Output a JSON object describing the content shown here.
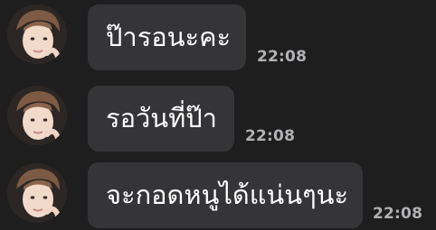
{
  "chat": {
    "messages": [
      {
        "text": "ป๊ารอนะคะ",
        "time": "22:08",
        "avatar": "user-avatar-icon"
      },
      {
        "text": "รอวันที่ป๊า",
        "time": "22:08",
        "avatar": "user-avatar-icon"
      },
      {
        "text": "จะกอดหนูได้แน่นๆนะ",
        "time": "22:08",
        "avatar": "user-avatar-icon"
      }
    ],
    "colors": {
      "background": "#1e1e1f",
      "bubble": "#353537",
      "text": "#ffffff",
      "time": "#b2b2b5"
    }
  }
}
